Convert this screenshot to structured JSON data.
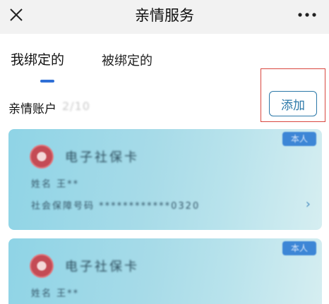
{
  "header": {
    "title": "亲情服务",
    "close_icon": "close-icon",
    "more_icon": "more-icon"
  },
  "tabs": [
    {
      "label": "我绑定的",
      "active": true
    },
    {
      "label": "被绑定的",
      "active": false
    }
  ],
  "account": {
    "label": "亲情账户",
    "number_masked": "2/10"
  },
  "add_button": {
    "label": "添加"
  },
  "colors": {
    "accent": "#2f6fd6",
    "button_border": "#2b78a8",
    "highlight": "#d9463e",
    "card": "#a7dbe8"
  },
  "cards": [
    {
      "badge": "本人",
      "title": "电子社保卡",
      "holder": "姓名 王**",
      "number": "社会保障号码 ************0320"
    },
    {
      "badge": "本人",
      "title": "电子社保卡",
      "holder": "姓名 王**"
    }
  ]
}
